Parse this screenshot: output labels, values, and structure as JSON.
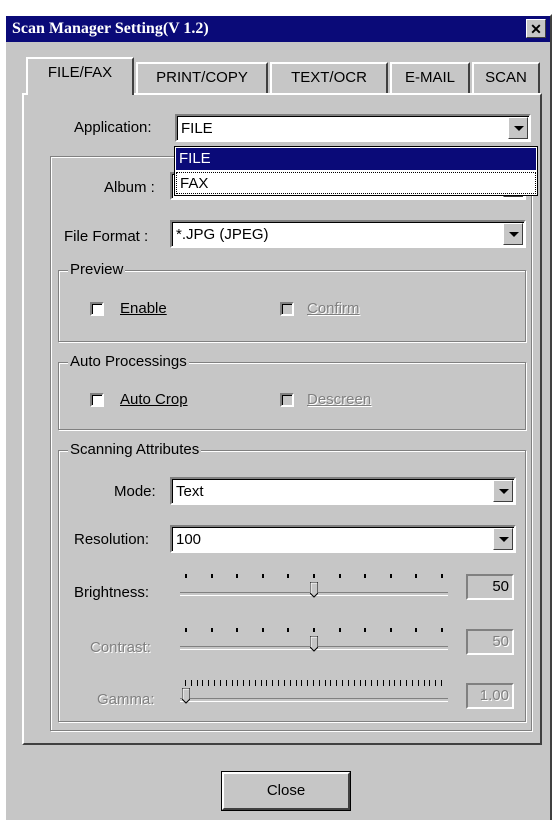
{
  "window": {
    "title": "Scan Manager Setting(V 1.2)",
    "close_glyph": "✕"
  },
  "tabs": [
    {
      "label": "FILE/FAX",
      "active": true
    },
    {
      "label": "PRINT/COPY",
      "active": false
    },
    {
      "label": "TEXT/OCR",
      "active": false
    },
    {
      "label": "E-MAIL",
      "active": false
    },
    {
      "label": "SCAN",
      "active": false
    }
  ],
  "application": {
    "label": "Application:",
    "value": "FILE",
    "options": [
      "FILE",
      "FAX"
    ],
    "highlighted": "FILE"
  },
  "album": {
    "label": "Album :"
  },
  "file_format": {
    "label": "File Format :",
    "value": "*.JPG (JPEG)"
  },
  "preview": {
    "title": "Preview",
    "enable_label": "Enable",
    "enable_checked": false,
    "confirm_label": "Confirm",
    "confirm_enabled": false
  },
  "auto_processing": {
    "title": "Auto Processings",
    "auto_crop_label": "Auto Crop",
    "auto_crop_checked": false,
    "descreen_label": "Descreen",
    "descreen_enabled": false
  },
  "scanning": {
    "title": "Scanning Attributes",
    "mode_label": "Mode:",
    "mode_value": "Text",
    "resolution_label": "Resolution:",
    "resolution_value": "100",
    "brightness_label": "Brightness:",
    "brightness_value": "50",
    "brightness_level": 0.5,
    "contrast_label": "Contrast:",
    "contrast_value": "50",
    "contrast_level": 0.5,
    "gamma_label": "Gamma:",
    "gamma_value": "1.00",
    "gamma_level": 0.0
  },
  "footer": {
    "close_label": "Close"
  },
  "colors": {
    "titlebar": "#0a0a78",
    "face": "#c6c6c6",
    "highlight": "#0a0a78"
  }
}
